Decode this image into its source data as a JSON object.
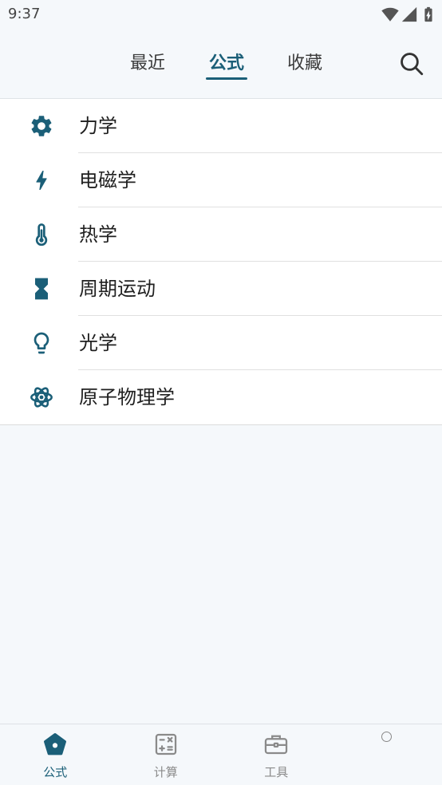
{
  "status_bar": {
    "time": "9:37",
    "icons": [
      "wifi-icon",
      "cell-signal-icon",
      "battery-charging-icon"
    ]
  },
  "header": {
    "tabs": [
      {
        "label": "最近",
        "active": false
      },
      {
        "label": "公式",
        "active": true
      },
      {
        "label": "收藏",
        "active": false
      }
    ],
    "search_icon": "search-icon"
  },
  "categories": [
    {
      "label": "力学",
      "icon": "gear-icon"
    },
    {
      "label": "电磁学",
      "icon": "lightning-icon"
    },
    {
      "label": "热学",
      "icon": "thermometer-icon"
    },
    {
      "label": "周期运动",
      "icon": "hourglass-icon"
    },
    {
      "label": "光学",
      "icon": "lightbulb-icon"
    },
    {
      "label": "原子物理学",
      "icon": "atom-icon"
    }
  ],
  "bottom_nav": [
    {
      "label": "公式",
      "icon": "home-pentagon-icon",
      "active": true
    },
    {
      "label": "计算",
      "icon": "calculator-icon",
      "active": false
    },
    {
      "label": "工具",
      "icon": "toolbox-icon",
      "active": false
    },
    {
      "icon": "circle-icon",
      "active": false
    }
  ],
  "colors": {
    "accent": "#1b5f78",
    "background": "#f5f8fb",
    "surface": "#ffffff",
    "text": "#1f1f1f",
    "inactive": "#8a8a8a"
  }
}
